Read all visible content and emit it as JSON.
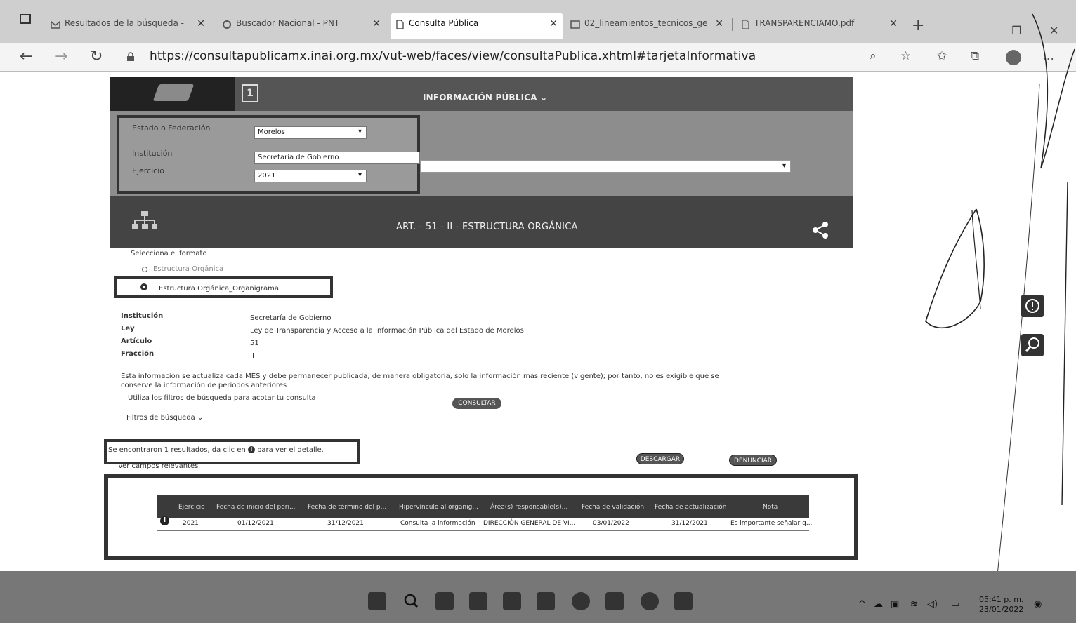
{
  "browser": {
    "tabs": [
      {
        "label": "Resultados de la búsqueda -",
        "icon": "gmail-icon"
      },
      {
        "label": "Buscador Nacional - PNT",
        "icon": "pnt-icon"
      },
      {
        "label": "Consulta Pública",
        "icon": "page-icon"
      },
      {
        "label": "02_lineamientos_tecnicos_ge",
        "icon": "pdf-icon"
      },
      {
        "label": "TRANSPARENCIAMO.pdf",
        "icon": "page-icon"
      }
    ],
    "url": "https://consultapublicamx.inai.org.mx/vut-web/faces/view/consultaPublica.xhtml#tarjetaInformativa"
  },
  "header": {
    "nav_label": "INFORMACIÓN PÚBLICA ⌄"
  },
  "filters": {
    "estado_label": "Estado o Federación",
    "estado_value": "Morelos",
    "institucion_label": "Institución",
    "institucion_value": "Secretaría de Gobierno",
    "ejercicio_label": "Ejercicio",
    "ejercicio_value": "2021"
  },
  "article": {
    "title": "ART. - 51 - II - ESTRUCTURA ORGÁNICA"
  },
  "format": {
    "prompt": "Selecciona el formato",
    "option1": "Estructura Orgánica",
    "option2": "Estructura Orgánica_Organigrama"
  },
  "info": {
    "rows": [
      {
        "key": "Institución",
        "value": "Secretaría de Gobierno"
      },
      {
        "key": "Ley",
        "value": "Ley de Transparencia y Acceso a la Información Pública del Estado de Morelos"
      },
      {
        "key": "Artículo",
        "value": "51"
      },
      {
        "key": "Fracción",
        "value": "II"
      }
    ],
    "notice": "Esta información se actualiza cada MES y debe permanecer publicada, de manera obligatoria, solo la información más reciente (vigente); por tanto, no es exigible que se conserve la información de periodos anteriores",
    "hint": "Utiliza los filtros de búsqueda para acotar tu consulta",
    "consultar": "CONSULTAR",
    "filters_toggle": "Filtros de búsqueda ⌄"
  },
  "results": {
    "text_before": "Se encontraron 1 resultados, da clic en",
    "text_after": "para ver el detalle.",
    "relevant": "Ver campos relevantes",
    "descargar": "DESCARGAR",
    "denunciar": "DENUNCIAR"
  },
  "table": {
    "headers": [
      "Ejercicio",
      "Fecha de inicio del peri...",
      "Fecha de término del p...",
      "Hipervínculo al organig...",
      "Área(s) responsable(s)...",
      "Fecha de validación",
      "Fecha de actualización",
      "Nota"
    ],
    "row": [
      "2021",
      "01/12/2021",
      "31/12/2021",
      "Consulta la información",
      "DIRECCIÓN GENERAL DE VI...",
      "03/01/2022",
      "31/12/2021",
      "Es importante señalar q..."
    ]
  },
  "clock": {
    "time": "05:41 p. m.",
    "date": "23/01/2022"
  }
}
